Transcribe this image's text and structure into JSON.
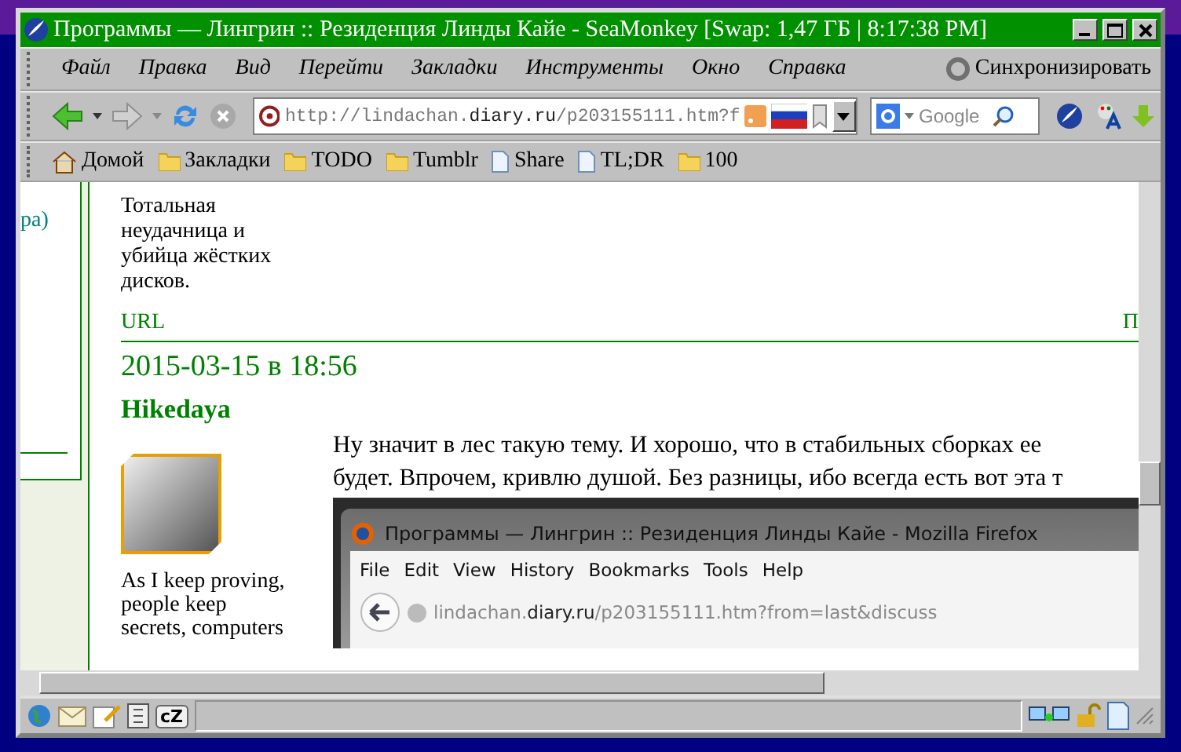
{
  "window": {
    "title": "Программы — Лингрин :: Резиденция Линды Кайе - SeaMonkey [Swap: 1,47 ГБ | 8:17:38 PM]"
  },
  "menu": [
    "Файл",
    "Правка",
    "Вид",
    "Перейти",
    "Закладки",
    "Инструменты",
    "Окно",
    "Справка"
  ],
  "sync": "Синхронизировать",
  "nav": {
    "url": {
      "before": "http://lindachan.",
      "domain": "diary.ru",
      "after": "/p203155111.htm?f"
    },
    "search_placeholder": "Google"
  },
  "bookmarks": [
    {
      "label": "Домой",
      "kind": "home"
    },
    {
      "label": "Закладки",
      "kind": "folder"
    },
    {
      "label": "TODO",
      "kind": "folder"
    },
    {
      "label": "Tumblr",
      "kind": "folder"
    },
    {
      "label": "Share",
      "kind": "page"
    },
    {
      "label": "TL;DR",
      "kind": "page"
    },
    {
      "label": "100",
      "kind": "folder"
    }
  ],
  "sidebar": {
    "text": "ра)"
  },
  "profile": {
    "about": "Тотальная неудачница и убийца жёстких дисков.",
    "link": "URL",
    "right_link": "П"
  },
  "post": {
    "date": "2015-03-15 в 18:56",
    "author": "Hikedaya",
    "signature": "As I keep proving, people keep secrets, computers",
    "lines": [
      "Ну значит в лес такую тему. И хорошо, что в стабильных сборках ее",
      "будет. Впрочем, кривлю душой. Без разницы, ибо всегда есть вот эта т"
    ],
    "screenshot": {
      "title": "Программы — Лингрин :: Резиденция Линды Кайе - Mozilla Firefox",
      "menu": [
        "File",
        "Edit",
        "View",
        "History",
        "Bookmarks",
        "Tools",
        "Help"
      ],
      "url": {
        "before": "lindachan.",
        "domain": "diary.ru",
        "after": "/p203155111.htm?from=last&discuss"
      }
    }
  },
  "status": {
    "chat": "cZ"
  }
}
